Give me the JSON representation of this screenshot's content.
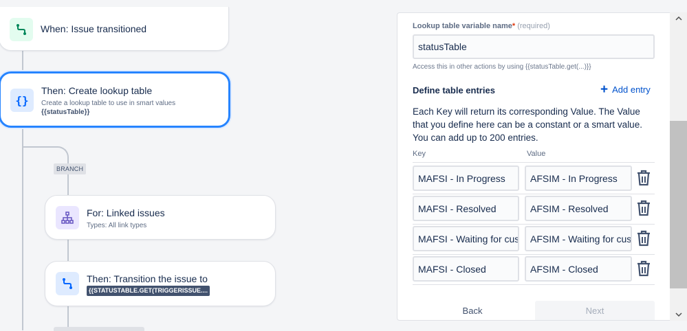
{
  "canvas": {
    "trigger": {
      "title": "When: Issue transitioned"
    },
    "lookup": {
      "title": "Then: Create lookup table",
      "subtitle": "Create a lookup table to use in smart values",
      "var": "{{statusTable}}"
    },
    "branch": {
      "tag": "BRANCH"
    },
    "linked": {
      "title": "For: Linked issues",
      "subtitle": "Types: All link types"
    },
    "transition": {
      "title": "Then: Transition the issue to",
      "chip": "{{STATUSTABLE.GET(TRIGGERISSUE...."
    }
  },
  "panel": {
    "var_label": "Lookup table variable name",
    "required_star": "*",
    "required_text": "(required)",
    "var_value": "statusTable",
    "helper": "Access this in other actions by using {{statusTable.get(...)}}",
    "section_title": "Define table entries",
    "add_entry": "Add entry",
    "description": "Each Key will return its corresponding Value. The Value that you define here can be a constant or a smart value. You can add up to 200 entries.",
    "key_header": "Key",
    "value_header": "Value",
    "entries": [
      {
        "key": "MAFSI - In Progress",
        "value": "AFSIM - In Progress"
      },
      {
        "key": "MAFSI - Resolved",
        "value": "AFSIM - Resolved"
      },
      {
        "key": "MAFSI - Waiting for customer",
        "value": "AFSIM - Waiting for customer"
      },
      {
        "key": "MAFSI - Closed",
        "value": "AFSIM - Closed"
      }
    ],
    "back": "Back",
    "next": "Next"
  },
  "colors": {
    "accent": "#0052cc",
    "selected_border": "#2684ff",
    "trigger_icon": "#00875a",
    "action_icon": "#0065ff",
    "branch_icon": "#6554c0"
  },
  "icons": {
    "trigger": "transition-icon",
    "lookup": "curly-braces-icon",
    "linked": "hierarchy-icon",
    "transition": "transition-icon",
    "add": "plus-icon",
    "delete": "trash-icon"
  }
}
